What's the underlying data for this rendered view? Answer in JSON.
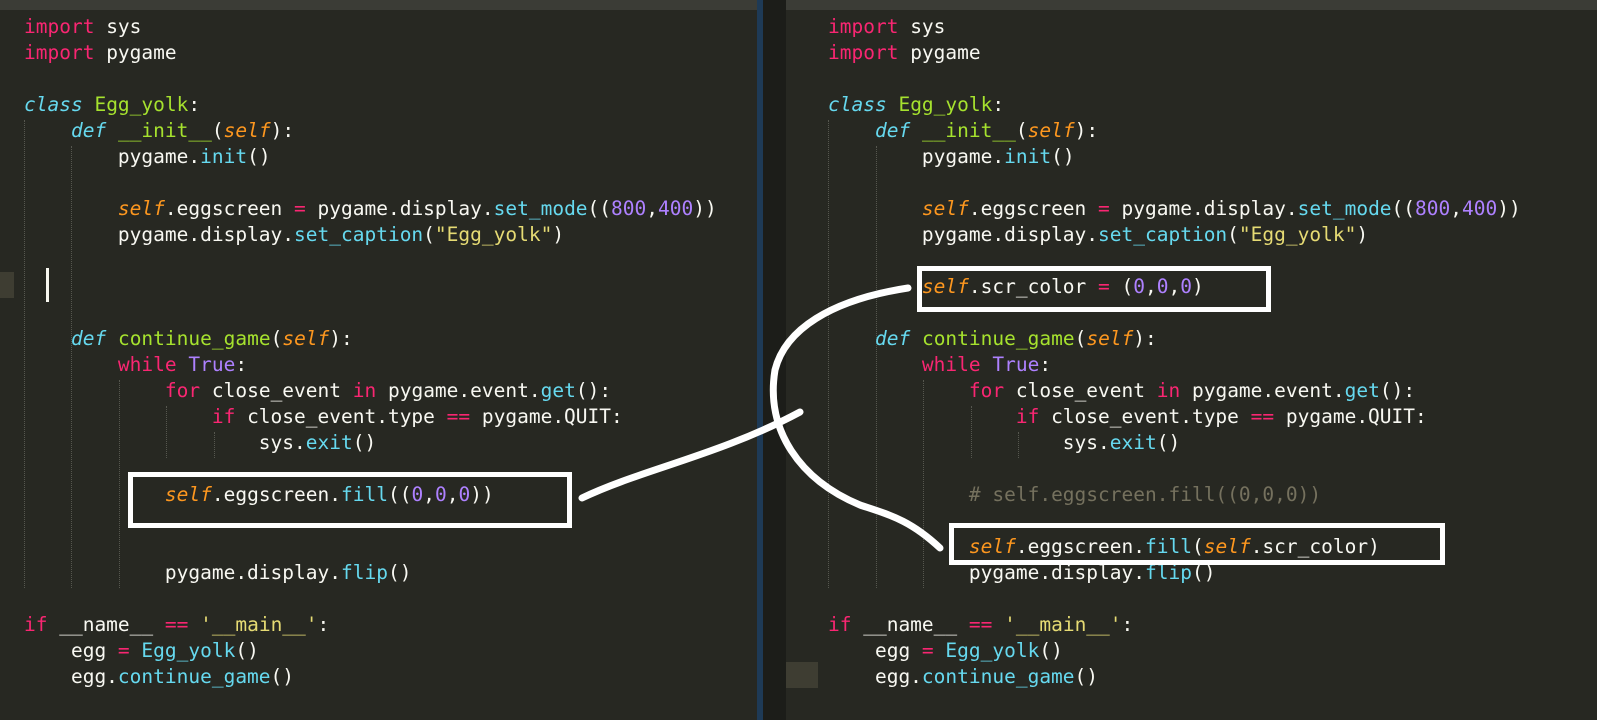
{
  "colors": {
    "background": "#272822",
    "keyword": "#f92672",
    "storage": "#66d9ef",
    "class_name": "#a6e22e",
    "self": "#fd971f",
    "number": "#ae81ff",
    "string": "#e6db74",
    "comment": "#75715e",
    "annotation": "#ffffff"
  },
  "left_editor": {
    "lines": [
      [
        {
          "t": "import",
          "c": "kw"
        },
        {
          "t": " sys"
        }
      ],
      [
        {
          "t": "import",
          "c": "kw"
        },
        {
          "t": " pygame"
        }
      ],
      [],
      [
        {
          "t": "class",
          "c": "kw2"
        },
        {
          "t": " "
        },
        {
          "t": "Egg_yolk",
          "c": "cls"
        },
        {
          "t": ":"
        }
      ],
      [
        {
          "t": "    "
        },
        {
          "t": "def",
          "c": "kw2"
        },
        {
          "t": " "
        },
        {
          "t": "__init__",
          "c": "cls"
        },
        {
          "t": "("
        },
        {
          "t": "self",
          "c": "self"
        },
        {
          "t": "):"
        }
      ],
      [
        {
          "t": "        pygame."
        },
        {
          "t": "init",
          "c": "fn"
        },
        {
          "t": "()"
        }
      ],
      [],
      [
        {
          "t": "        "
        },
        {
          "t": "self",
          "c": "self"
        },
        {
          "t": ".eggscreen "
        },
        {
          "t": "=",
          "c": "kw"
        },
        {
          "t": " pygame.display."
        },
        {
          "t": "set_mode",
          "c": "fn"
        },
        {
          "t": "(("
        },
        {
          "t": "800",
          "c": "num"
        },
        {
          "t": ","
        },
        {
          "t": "400",
          "c": "num"
        },
        {
          "t": "))"
        }
      ],
      [
        {
          "t": "        pygame.display."
        },
        {
          "t": "set_caption",
          "c": "fn"
        },
        {
          "t": "("
        },
        {
          "t": "\"Egg_yolk\"",
          "c": "str"
        },
        {
          "t": ")"
        }
      ],
      [],
      [],
      [],
      [
        {
          "t": "    "
        },
        {
          "t": "def",
          "c": "kw2"
        },
        {
          "t": " "
        },
        {
          "t": "continue_game",
          "c": "cls"
        },
        {
          "t": "("
        },
        {
          "t": "self",
          "c": "self"
        },
        {
          "t": "):"
        }
      ],
      [
        {
          "t": "        "
        },
        {
          "t": "while",
          "c": "kw"
        },
        {
          "t": " "
        },
        {
          "t": "True",
          "c": "const"
        },
        {
          "t": ":"
        }
      ],
      [
        {
          "t": "            "
        },
        {
          "t": "for",
          "c": "kw"
        },
        {
          "t": " close_event "
        },
        {
          "t": "in",
          "c": "kw"
        },
        {
          "t": " pygame.event."
        },
        {
          "t": "get",
          "c": "fn"
        },
        {
          "t": "():"
        }
      ],
      [
        {
          "t": "                "
        },
        {
          "t": "if",
          "c": "kw"
        },
        {
          "t": " close_event.type "
        },
        {
          "t": "==",
          "c": "kw"
        },
        {
          "t": " pygame.QUIT:"
        }
      ],
      [
        {
          "t": "                    sys."
        },
        {
          "t": "exit",
          "c": "fn"
        },
        {
          "t": "()"
        }
      ],
      [],
      [
        {
          "t": "            "
        },
        {
          "t": "self",
          "c": "self"
        },
        {
          "t": ".eggscreen."
        },
        {
          "t": "fill",
          "c": "fn"
        },
        {
          "t": "(("
        },
        {
          "t": "0",
          "c": "num"
        },
        {
          "t": ","
        },
        {
          "t": "0",
          "c": "num"
        },
        {
          "t": ","
        },
        {
          "t": "0",
          "c": "num"
        },
        {
          "t": "))"
        }
      ],
      [],
      [],
      [
        {
          "t": "            pygame.display."
        },
        {
          "t": "flip",
          "c": "fn"
        },
        {
          "t": "()"
        }
      ],
      [],
      [
        {
          "t": "if",
          "c": "kw"
        },
        {
          "t": " __name__ "
        },
        {
          "t": "==",
          "c": "kw"
        },
        {
          "t": " "
        },
        {
          "t": "'__main__'",
          "c": "str"
        },
        {
          "t": ":"
        }
      ],
      [
        {
          "t": "    egg "
        },
        {
          "t": "=",
          "c": "kw"
        },
        {
          "t": " "
        },
        {
          "t": "Egg_yolk",
          "c": "fn"
        },
        {
          "t": "()"
        }
      ],
      [
        {
          "t": "    egg."
        },
        {
          "t": "continue_game",
          "c": "fn"
        },
        {
          "t": "()"
        }
      ]
    ]
  },
  "right_editor": {
    "lines": [
      [
        {
          "t": "import",
          "c": "kw"
        },
        {
          "t": " sys"
        }
      ],
      [
        {
          "t": "import",
          "c": "kw"
        },
        {
          "t": " pygame"
        }
      ],
      [],
      [
        {
          "t": "class",
          "c": "kw2"
        },
        {
          "t": " "
        },
        {
          "t": "Egg_yolk",
          "c": "cls"
        },
        {
          "t": ":"
        }
      ],
      [
        {
          "t": "    "
        },
        {
          "t": "def",
          "c": "kw2"
        },
        {
          "t": " "
        },
        {
          "t": "__init__",
          "c": "cls"
        },
        {
          "t": "("
        },
        {
          "t": "self",
          "c": "self"
        },
        {
          "t": "):"
        }
      ],
      [
        {
          "t": "        pygame."
        },
        {
          "t": "init",
          "c": "fn"
        },
        {
          "t": "()"
        }
      ],
      [],
      [
        {
          "t": "        "
        },
        {
          "t": "self",
          "c": "self"
        },
        {
          "t": ".eggscreen "
        },
        {
          "t": "=",
          "c": "kw"
        },
        {
          "t": " pygame.display."
        },
        {
          "t": "set_mode",
          "c": "fn"
        },
        {
          "t": "(("
        },
        {
          "t": "800",
          "c": "num"
        },
        {
          "t": ","
        },
        {
          "t": "400",
          "c": "num"
        },
        {
          "t": "))"
        }
      ],
      [
        {
          "t": "        pygame.display."
        },
        {
          "t": "set_caption",
          "c": "fn"
        },
        {
          "t": "("
        },
        {
          "t": "\"Egg_yolk\"",
          "c": "str"
        },
        {
          "t": ")"
        }
      ],
      [],
      [
        {
          "t": "        "
        },
        {
          "t": "self",
          "c": "self"
        },
        {
          "t": ".scr_color "
        },
        {
          "t": "=",
          "c": "kw"
        },
        {
          "t": " ("
        },
        {
          "t": "0",
          "c": "num"
        },
        {
          "t": ","
        },
        {
          "t": "0",
          "c": "num"
        },
        {
          "t": ","
        },
        {
          "t": "0",
          "c": "num"
        },
        {
          "t": ")"
        }
      ],
      [],
      [
        {
          "t": "    "
        },
        {
          "t": "def",
          "c": "kw2"
        },
        {
          "t": " "
        },
        {
          "t": "continue_game",
          "c": "cls"
        },
        {
          "t": "("
        },
        {
          "t": "self",
          "c": "self"
        },
        {
          "t": "):"
        }
      ],
      [
        {
          "t": "        "
        },
        {
          "t": "while",
          "c": "kw"
        },
        {
          "t": " "
        },
        {
          "t": "True",
          "c": "const"
        },
        {
          "t": ":"
        }
      ],
      [
        {
          "t": "            "
        },
        {
          "t": "for",
          "c": "kw"
        },
        {
          "t": " close_event "
        },
        {
          "t": "in",
          "c": "kw"
        },
        {
          "t": " pygame.event."
        },
        {
          "t": "get",
          "c": "fn"
        },
        {
          "t": "():"
        }
      ],
      [
        {
          "t": "                "
        },
        {
          "t": "if",
          "c": "kw"
        },
        {
          "t": " close_event.type "
        },
        {
          "t": "==",
          "c": "kw"
        },
        {
          "t": " pygame.QUIT:"
        }
      ],
      [
        {
          "t": "                    sys."
        },
        {
          "t": "exit",
          "c": "fn"
        },
        {
          "t": "()"
        }
      ],
      [],
      [
        {
          "t": "            "
        },
        {
          "t": "# self.eggscreen.fill((0,0,0))",
          "c": "cmt"
        }
      ],
      [],
      [
        {
          "t": "            "
        },
        {
          "t": "self",
          "c": "self"
        },
        {
          "t": ".eggscreen."
        },
        {
          "t": "fill",
          "c": "fn"
        },
        {
          "t": "("
        },
        {
          "t": "self",
          "c": "self"
        },
        {
          "t": ".scr_color)"
        }
      ],
      [
        {
          "t": "            pygame.display."
        },
        {
          "t": "flip",
          "c": "fn"
        },
        {
          "t": "()"
        }
      ],
      [],
      [
        {
          "t": "if",
          "c": "kw"
        },
        {
          "t": " __name__ "
        },
        {
          "t": "==",
          "c": "kw"
        },
        {
          "t": " "
        },
        {
          "t": "'__main__'",
          "c": "str"
        },
        {
          "t": ":"
        }
      ],
      [
        {
          "t": "    egg "
        },
        {
          "t": "=",
          "c": "kw"
        },
        {
          "t": " "
        },
        {
          "t": "Egg_yolk",
          "c": "fn"
        },
        {
          "t": "()"
        }
      ],
      [
        {
          "t": "    egg."
        },
        {
          "t": "continue_game",
          "c": "fn"
        },
        {
          "t": "()"
        }
      ]
    ]
  }
}
